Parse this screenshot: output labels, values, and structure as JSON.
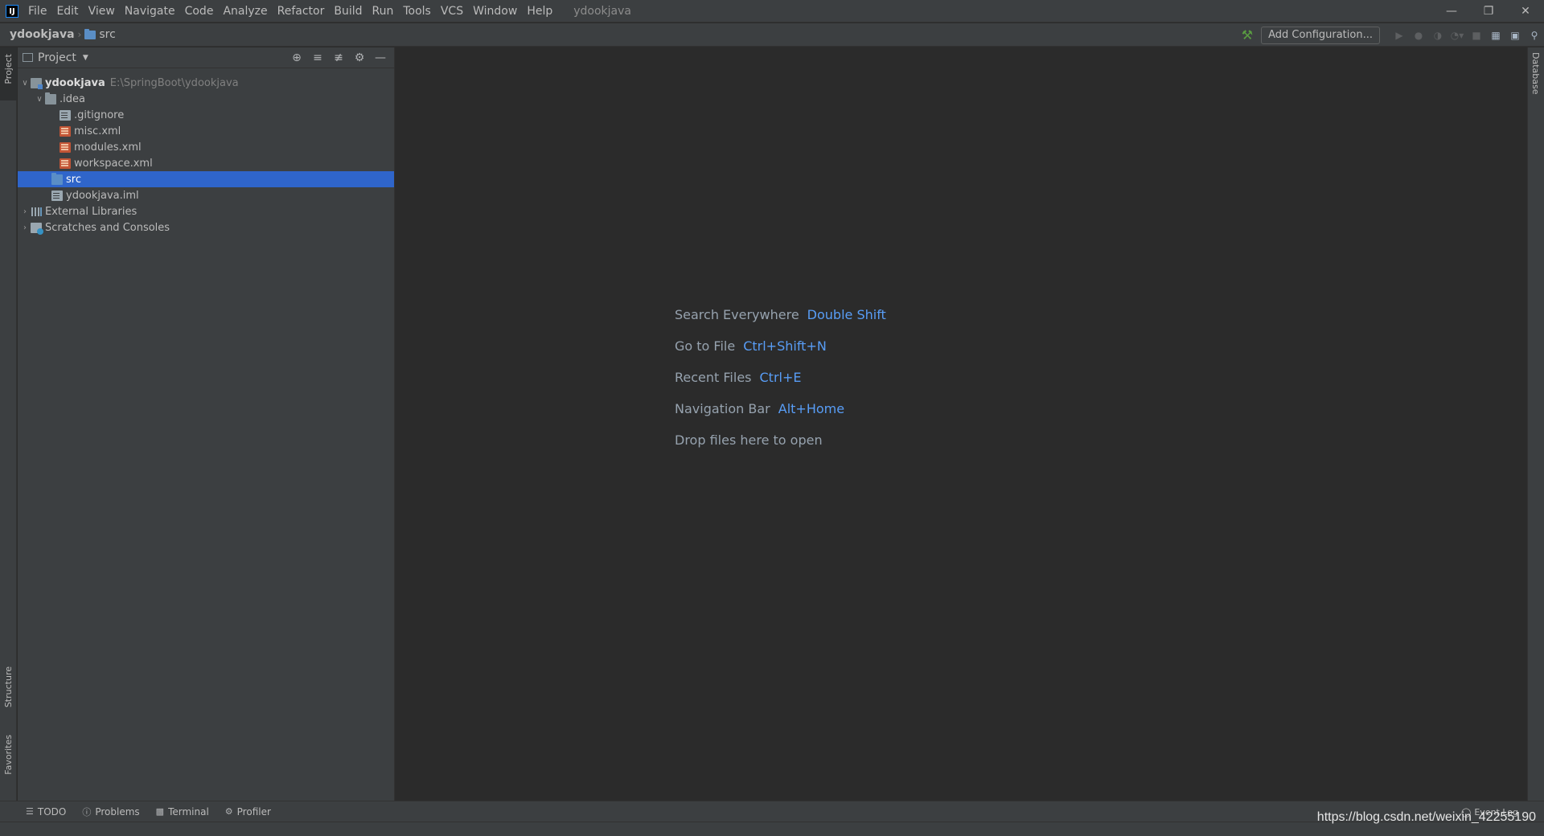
{
  "window": {
    "title": "ydookjava",
    "logo": "IJ",
    "controls": {
      "minimize_icon": "minimize-icon",
      "restore_icon": "restore-icon",
      "close_icon": "close-icon"
    }
  },
  "menu": [
    "File",
    "Edit",
    "View",
    "Navigate",
    "Code",
    "Analyze",
    "Refactor",
    "Build",
    "Run",
    "Tools",
    "VCS",
    "Window",
    "Help"
  ],
  "navbar": {
    "project": "ydookjava",
    "folder": "src",
    "add_configuration": "Add Configuration..."
  },
  "left_tabs": {
    "project": "Project",
    "structure": "Structure",
    "favorites": "Favorites"
  },
  "right_tabs": {
    "database": "Database"
  },
  "project_panel": {
    "title": "Project",
    "tree": [
      {
        "label": "ydookjava",
        "hint": "E:\\SpringBoot\\ydookjava",
        "icon": "module-folder",
        "expanded": true,
        "level": 0
      },
      {
        "label": ".idea",
        "icon": "folder",
        "expanded": true,
        "level": 1
      },
      {
        "label": ".gitignore",
        "icon": "file",
        "level": 2
      },
      {
        "label": "misc.xml",
        "icon": "xml",
        "level": 2
      },
      {
        "label": "modules.xml",
        "icon": "xml",
        "level": 2
      },
      {
        "label": "workspace.xml",
        "icon": "xml",
        "level": 2
      },
      {
        "label": "src",
        "icon": "source-folder",
        "level": 1,
        "selected": true
      },
      {
        "label": "ydookjava.iml",
        "icon": "file",
        "level": 1
      },
      {
        "label": "External Libraries",
        "icon": "libraries",
        "expanded": false,
        "level": 0
      },
      {
        "label": "Scratches and Consoles",
        "icon": "scratches",
        "expanded": false,
        "level": 0
      }
    ]
  },
  "editor_hints": [
    {
      "label": "Search Everywhere",
      "key": "Double Shift"
    },
    {
      "label": "Go to File",
      "key": "Ctrl+Shift+N"
    },
    {
      "label": "Recent Files",
      "key": "Ctrl+E"
    },
    {
      "label": "Navigation Bar",
      "key": "Alt+Home"
    },
    {
      "label": "Drop files here to open",
      "key": ""
    }
  ],
  "bottom_tabs": [
    "TODO",
    "Problems",
    "Terminal",
    "Profiler"
  ],
  "event_log": "Event Log",
  "watermark": "https://blog.csdn.net/weixin_42255190",
  "colors": {
    "accent": "#589df6",
    "selection": "#2f65ca",
    "background": "#2b2b2b",
    "panel": "#3c3f41"
  }
}
